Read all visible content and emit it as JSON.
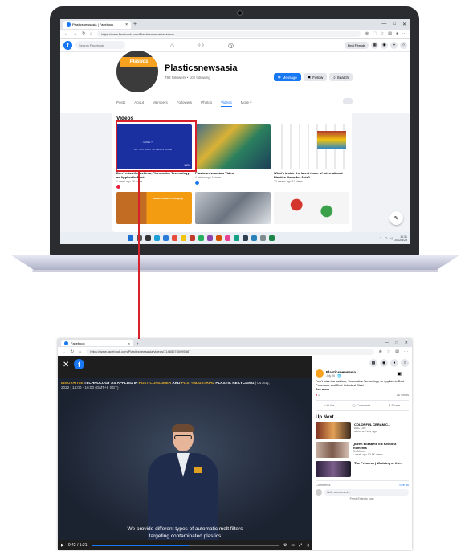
{
  "laptop": {
    "browser": {
      "tab_title": "Plasticsnewsasia | Facebook",
      "url": "https://www.facebook.com/Plasticsnewsasia/videos",
      "window_controls": [
        "—",
        "□",
        "✕"
      ]
    },
    "fbnav": {
      "logo": "f",
      "search_placeholder": "Search Facebook",
      "find_friends_label": "Find Friends"
    },
    "profile": {
      "avatar_text": "Plastics",
      "name": "Plasticsnewsasia",
      "followers": "798 followers • 102 following",
      "message_label": "Message",
      "follow_label": "Follow",
      "search_label": "Search",
      "tabs": [
        "Posts",
        "About",
        "Members",
        "Followers",
        "Photos",
        "Videos",
        "More ▾"
      ],
      "active_tab": "Videos",
      "more_button": "···"
    },
    "videos": {
      "heading": "Videos",
      "items": [
        {
          "thumb_text_1": "... MORE ?",
          "thumb_text_2": "DO YOU WANT TO LEARN MORE ?",
          "duration": "1:21",
          "title": "Don't miss the webinar, \"Innovative Technology as Applied in Post...",
          "meta": "1 week ago  26 views"
        },
        {
          "title": "Plasticsnewsasia's Video",
          "meta": "4 weeks ago  4 views"
        },
        {
          "title": "What's inside the latest issue of International Plastics News for Asia?...",
          "meta": "22 weeks ago  11 views"
        }
      ],
      "row2": [
        {
          "ad_text": "DGBS Plastics Packaging"
        },
        {},
        {}
      ]
    },
    "taskbar": {
      "time": "10:31",
      "date": "2022/8/23"
    }
  },
  "zoom": {
    "browser": {
      "tab_title": "Facebook",
      "url": "https://www.facebook.com/Plasticsnewsasia/videos/714650780095367"
    },
    "close_icon": "✕",
    "logo": "f",
    "video": {
      "headline_part1": "INNOVATIVE",
      "headline_part2": " TECHNOLOGY AS APPLIED IN ",
      "headline_part3": "POST-CONSUMER",
      "headline_part4": " AND ",
      "headline_part5": "POST-INDUSTRIAL",
      "headline_part6": " PLASTIC RECYCLING",
      "headline_date": " | 04 Aug, 2022 | 14:00 - 16:00 (GMT+8 SGT)",
      "subtitle_line1": "We provide different types of automatic melt filters",
      "subtitle_line2": "targeting contaminated plastics",
      "time": "0:42 / 1:21",
      "progress": 0.52
    },
    "side": {
      "poster_name": "Plasticsnewsasia",
      "poster_date": "July 26 · 🌐",
      "description": "Don't miss the webinar, \"Innovative Technology as Applied in Post-Consumer and Post-Industrial Plast...",
      "see_more": "See more",
      "reactions": "2",
      "views": "26 Views",
      "like_label": "Like",
      "comment_label": "Comment",
      "share_label": "Share",
      "up_next": "Up Next",
      "upnext_items": [
        {
          "title": "COLORFUL CERAMIC...",
          "source": "ABC Live",
          "meta": "about an hour ago"
        },
        {
          "title": "Queen Elizabeth II's funniest moments",
          "source": "TheMirror",
          "meta": "1 week ago  13.8K views"
        },
        {
          "title": "The Princess | Wedding of the...",
          "source": "",
          "meta": ""
        }
      ],
      "comments_label": "Comments",
      "see_all": "See All",
      "comment_placeholder": "Write a comment...",
      "press_enter": "Press Enter to post."
    }
  }
}
